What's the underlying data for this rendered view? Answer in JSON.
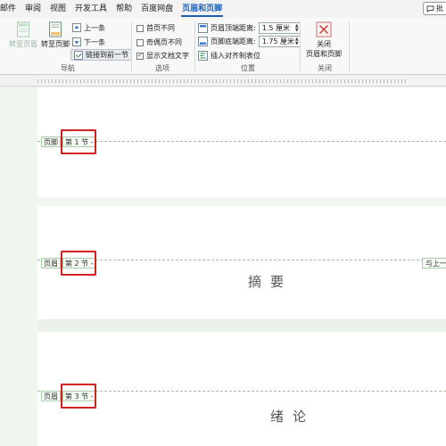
{
  "menu": {
    "items": [
      "邮件",
      "审阅",
      "视图",
      "开发工具",
      "帮助",
      "百度网盘",
      "页眉和页脚"
    ],
    "active_index": 6,
    "comment_label": "批"
  },
  "ribbon": {
    "navigation": {
      "goto_header": "转至页眉",
      "goto_footer": "转至页脚",
      "previous": "上一条",
      "next": "下一条",
      "link_previous": "链接到前一节",
      "group_label": "导航"
    },
    "options": {
      "different_first": "首页不同",
      "different_odd_even": "奇偶页不同",
      "show_doc_text": "显示文档文字",
      "different_first_checked": false,
      "different_odd_even_checked": false,
      "show_doc_text_checked": true,
      "check_mark": "✓",
      "group_label": "选项"
    },
    "position": {
      "header_top_label": "页眉顶端距离:",
      "header_top_value": "1.5 厘米",
      "footer_bottom_label": "页脚底端距离:",
      "footer_bottom_value": "1.75 厘米",
      "insert_align_tab": "插入对齐制表位",
      "group_label": "位置"
    },
    "close": {
      "line1": "关闭",
      "line2": "页眉和页脚",
      "group_label": "关闭"
    }
  },
  "document": {
    "page1": {
      "footer_label": "页脚",
      "section_label": "第 1 节 -"
    },
    "page2": {
      "header_label": "页眉",
      "section_label": "第 2 节 -",
      "link_prev_label": "与上一",
      "heading": "摘要"
    },
    "page3": {
      "header_label": "页眉",
      "section_label": "第 3 节 -",
      "heading": "绪论"
    }
  },
  "colors": {
    "accent": "#1f5fb4",
    "highlight_box": "#d32222",
    "hf_border": "#a8d0a8"
  }
}
